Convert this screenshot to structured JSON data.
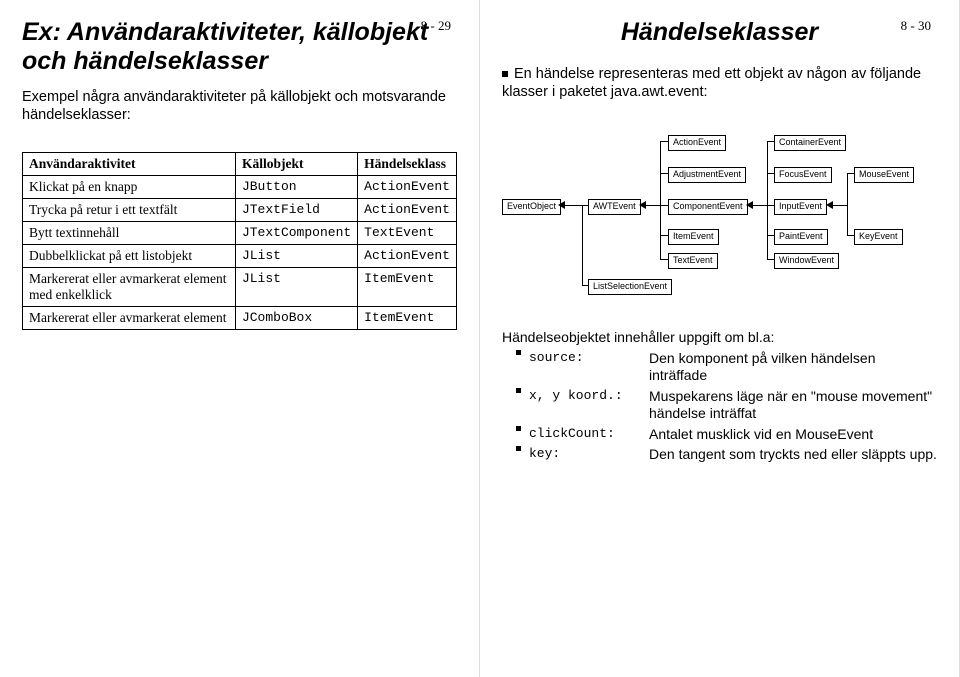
{
  "left": {
    "page": "8 - 29",
    "title": "Ex: Användaraktiviteter, källobjekt och händelseklasser",
    "intro": "Exempel några användaraktiviteter på källobjekt och motsvarande händelseklasser:",
    "headers": {
      "c0": "Användaraktivitet",
      "c1": "Källobjekt",
      "c2": "Händelseklass"
    },
    "rows": [
      {
        "a": "Klickat på en knapp",
        "k": "JButton",
        "h": "ActionEvent"
      },
      {
        "a": "Trycka på retur i ett textfält",
        "k": "JTextField",
        "h": "ActionEvent"
      },
      {
        "a": "Bytt textinnehåll",
        "k": "JTextComponent",
        "h": "TextEvent"
      },
      {
        "a": "Dubbelklickat på ett listobjekt",
        "k": "JList",
        "h": "ActionEvent"
      },
      {
        "a": "Markererat eller avmarkerat element med enkelklick",
        "k": "JList",
        "h": "ItemEvent"
      },
      {
        "a": "Markererat eller avmarkerat element",
        "k": "JComboBox",
        "h": "ItemEvent"
      }
    ]
  },
  "right": {
    "page": "8 - 30",
    "title": "Händelseklasser",
    "intro": "En händelse representeras med ett objekt av någon av följande klasser i paketet java.awt.event:",
    "nodes": {
      "eventobject": "EventObject",
      "awtevent": "AWTEvent",
      "listselection": "ListSelectionEvent",
      "actionevent": "ActionEvent",
      "adjustment": "AdjustmentEvent",
      "component": "ComponentEvent",
      "item": "ItemEvent",
      "textevent": "TextEvent",
      "container": "ContainerEvent",
      "focus": "FocusEvent",
      "input": "InputEvent",
      "paint": "PaintEvent",
      "window": "WindowEvent",
      "mouse": "MouseEvent",
      "key": "KeyEvent"
    },
    "footer_title": "Händelseobjektet innehåller uppgift om bl.a:",
    "footer": [
      {
        "lab": "source:",
        "desc": "Den komponent på vilken händelsen inträffade"
      },
      {
        "lab": "x, y koord.:",
        "desc": "Muspekarens läge när en \"mouse movement\" händelse inträffat"
      },
      {
        "lab": "clickCount:",
        "desc": "Antalet musklick vid en MouseEvent"
      },
      {
        "lab": "key:",
        "desc": "Den tangent som tryckts ned eller släppts upp."
      }
    ]
  }
}
